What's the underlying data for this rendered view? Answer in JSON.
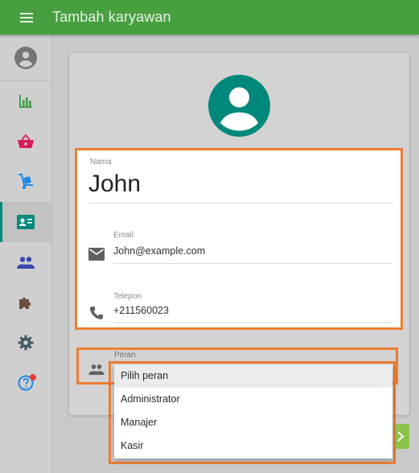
{
  "appbar": {
    "title": "Tambah karyawan",
    "menu_icon": "menu-icon",
    "color": "#47a03f"
  },
  "sidebar": {
    "avatar_icon": "account-circle-icon",
    "items": [
      {
        "icon": "bar-chart-icon",
        "color": "#43a047",
        "active": false
      },
      {
        "icon": "shopping-basket-icon",
        "color": "#d81b60",
        "active": false
      },
      {
        "icon": "hand-truck-icon",
        "color": "#1e88e5",
        "active": false
      },
      {
        "icon": "contact-card-icon",
        "color": "#00897b",
        "active": true
      },
      {
        "icon": "people-icon",
        "color": "#3949ab",
        "active": false
      },
      {
        "icon": "puzzle-icon",
        "color": "#6d4c41",
        "active": false
      },
      {
        "icon": "gear-icon",
        "color": "#455a64",
        "active": false
      },
      {
        "icon": "help-icon",
        "color": "#1e88e5",
        "active": false,
        "badge": true
      }
    ]
  },
  "form": {
    "avatar_icon": "account-circle-icon",
    "avatar_color": "#00897b",
    "name_label": "Nama",
    "name_value": "John",
    "email_label": "Email",
    "email_value": "John@example.com",
    "phone_label": "Telepon",
    "phone_value": "+211560023",
    "role_label": "Peran"
  },
  "role_dropdown": {
    "options": [
      "Pilih peran",
      "Administrator",
      "Manajer",
      "Kasir"
    ],
    "highlighted": "Pilih peran"
  },
  "highlight_color": "#ed7d31"
}
